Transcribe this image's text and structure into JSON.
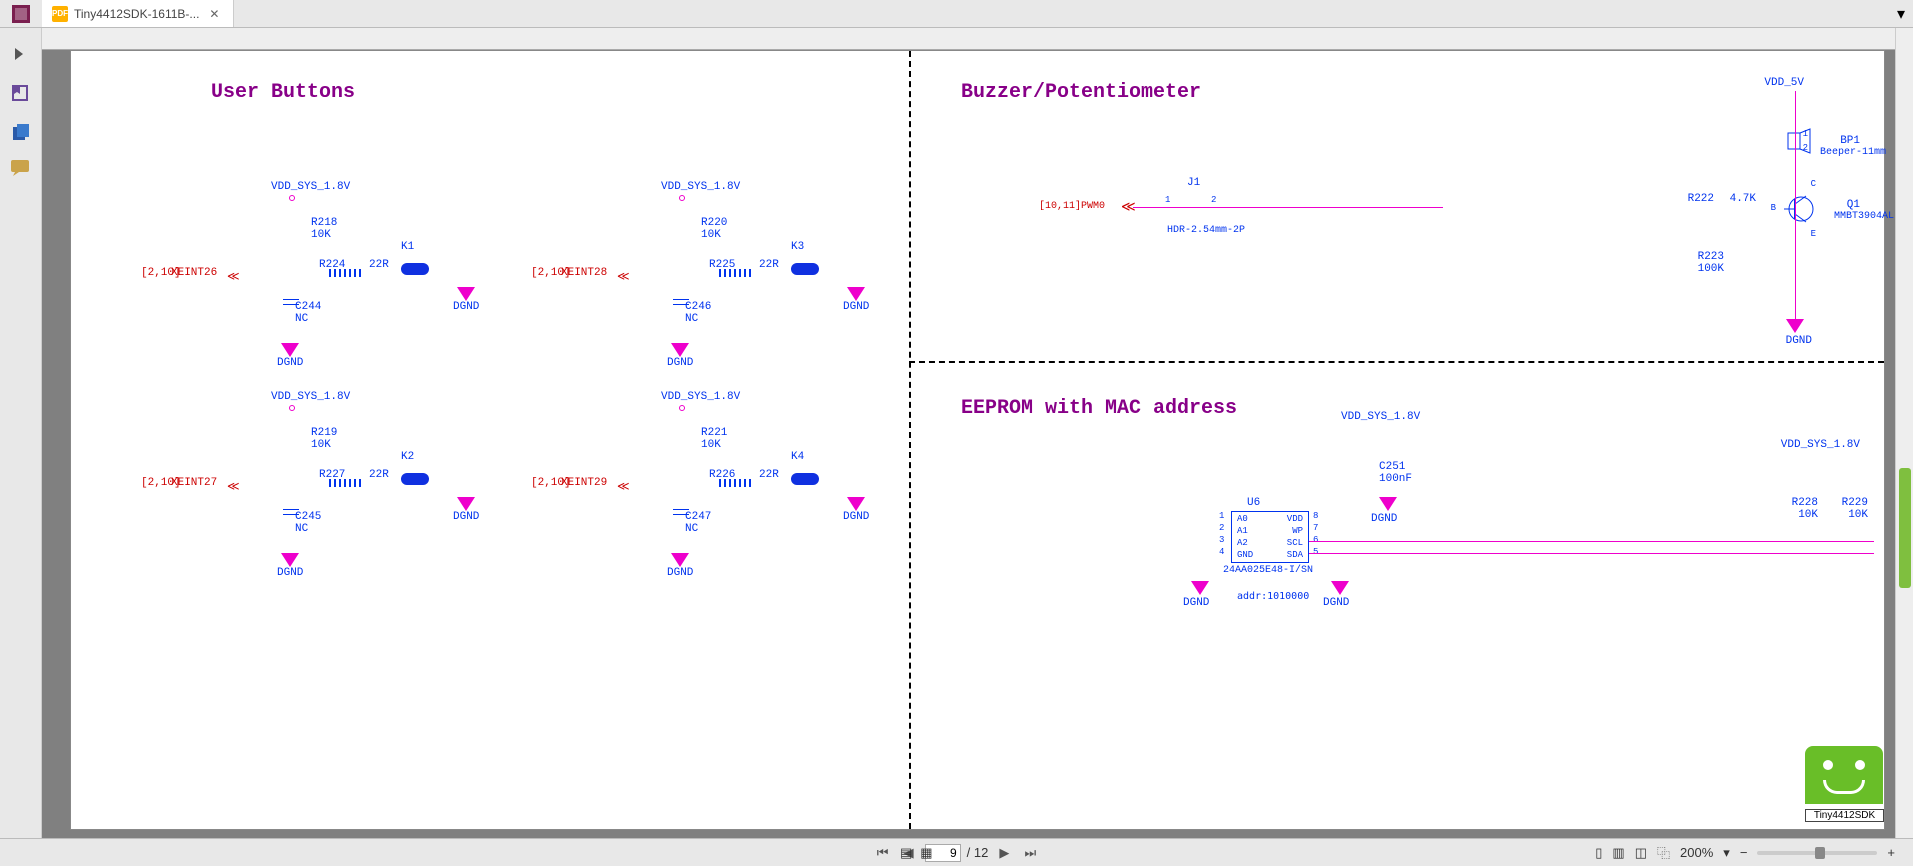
{
  "app": {
    "tab_title": "Tiny4412SDK-1611B-...",
    "pdf_icon_text": "PDF"
  },
  "sections": {
    "user_buttons": "User Buttons",
    "buzzer": "Buzzer/Potentiometer",
    "eeprom": "EEPROM with MAC address"
  },
  "buttons": [
    {
      "vdd": "VDD_SYS_1.8V",
      "r_pull": "R218",
      "r_pull_v": "10K",
      "r_ser": "R224",
      "r_ser_v": "22R",
      "k": "K1",
      "cap": "C244",
      "nc": "NC",
      "port": "XEINT26",
      "sheet": "[2,10]",
      "dgnd": "DGND"
    },
    {
      "vdd": "VDD_SYS_1.8V",
      "r_pull": "R220",
      "r_pull_v": "10K",
      "r_ser": "R225",
      "r_ser_v": "22R",
      "k": "K3",
      "cap": "C246",
      "nc": "NC",
      "port": "XEINT28",
      "sheet": "[2,10]",
      "dgnd": "DGND"
    },
    {
      "vdd": "VDD_SYS_1.8V",
      "r_pull": "R219",
      "r_pull_v": "10K",
      "r_ser": "R227",
      "r_ser_v": "22R",
      "k": "K2",
      "cap": "C245",
      "nc": "NC",
      "port": "XEINT27",
      "sheet": "[2,10]",
      "dgnd": "DGND"
    },
    {
      "vdd": "VDD_SYS_1.8V",
      "r_pull": "R221",
      "r_pull_v": "10K",
      "r_ser": "R226",
      "r_ser_v": "22R",
      "k": "K4",
      "cap": "C247",
      "nc": "NC",
      "port": "XEINT29",
      "sheet": "[2,10]",
      "dgnd": "DGND"
    }
  ],
  "buzzer": {
    "vdd": "VDD_5V",
    "bp": "BP1",
    "bp_model": "Beeper-11mm",
    "q": "Q1",
    "q_model": "MMBT3904AL",
    "rbase": "R222",
    "rbase_v": "4.7K",
    "remit": "R223",
    "remit_v": "100K",
    "j": "J1",
    "j_model": "HDR-2.54mm-2P",
    "pwm": "PWM0",
    "pwm_sheet": "[10,11]",
    "dgnd": "DGND",
    "pins": {
      "b": "B",
      "c": "C",
      "e": "E",
      "p1": "1",
      "p2": "2"
    }
  },
  "eeprom": {
    "u": "U6",
    "model": "24AA025E48-I/SN",
    "addr": "addr:1010000",
    "cap": "C251",
    "cap_v": "100nF",
    "vdd1": "VDD_SYS_1.8V",
    "vdd2": "VDD_SYS_1.8V",
    "r1": "R228",
    "r1_v": "10K",
    "r2": "R229",
    "r2_v": "10K",
    "pins": {
      "a0": "A0",
      "a1": "A1",
      "a2": "A2",
      "gnd": "GND",
      "vdd": "VDD",
      "wp": "WP",
      "scl": "SCL",
      "sda": "SDA",
      "n1": "1",
      "n2": "2",
      "n3": "3",
      "n4": "4",
      "n5": "5",
      "n6": "6",
      "n7": "7",
      "n8": "8"
    },
    "dgnd": "DGND"
  },
  "labels": {
    "dgnd": "DGND"
  },
  "nav": {
    "page": "9",
    "total": "/ 12",
    "zoom": "200%"
  },
  "widget": {
    "caption": "Tiny4412SDK"
  }
}
